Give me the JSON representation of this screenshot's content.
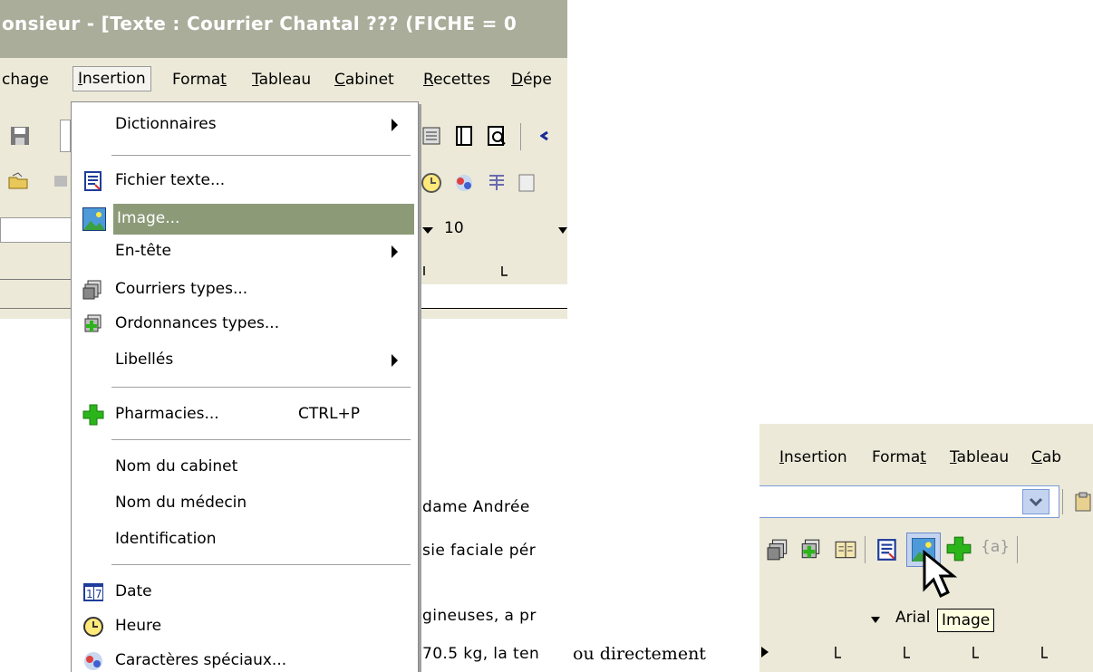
{
  "window": {
    "title": "onsieur - [Texte : Courrier Chantal ??? (FICHE = 0"
  },
  "menubar": {
    "items": [
      {
        "pre": "",
        "u": "",
        "post": "chage"
      },
      {
        "pre": "",
        "u": "I",
        "post": "nsertion"
      },
      {
        "pre": "Forma",
        "u": "t",
        "post": ""
      },
      {
        "pre": "",
        "u": "T",
        "post": "ableau"
      },
      {
        "pre": "",
        "u": "C",
        "post": "abinet"
      },
      {
        "pre": "",
        "u": "R",
        "post": "ecettes"
      },
      {
        "pre": "",
        "u": "D",
        "post": "épe"
      }
    ]
  },
  "toolbar": {
    "font_size": "10"
  },
  "insertion_menu": {
    "items": [
      {
        "label": "Dictionnaires",
        "icon": "none",
        "submenu": true
      },
      {
        "label": "Fichier texte...",
        "icon": "text-file-icon"
      },
      {
        "label": "Image...",
        "icon": "image-icon",
        "highlighted": true
      },
      {
        "label": "En-tête",
        "icon": "none",
        "submenu": true
      },
      {
        "label": "Courriers types...",
        "icon": "letter-templates-icon"
      },
      {
        "label": "Ordonnances types...",
        "icon": "prescription-templates-icon"
      },
      {
        "label": "Libellés",
        "icon": "none",
        "submenu": true
      },
      {
        "label": "Pharmacies...",
        "icon": "green-cross-icon",
        "shortcut": "CTRL+P"
      },
      {
        "label": "Nom du cabinet",
        "icon": "none"
      },
      {
        "label": "Nom du médecin",
        "icon": "none"
      },
      {
        "label": "Identification",
        "icon": "none"
      },
      {
        "label": "Date",
        "icon": "calendar-icon"
      },
      {
        "label": "Heure",
        "icon": "clock-icon"
      },
      {
        "label": "Caractères spéciaux...",
        "icon": "special-characters-icon"
      }
    ]
  },
  "document": {
    "lines": [
      "dame Andrée",
      "sie faciale pér",
      "gineuses, a pr",
      "70.5 kg, la ten"
    ]
  },
  "caption": "ou directement",
  "inset": {
    "menu_items": [
      {
        "pre": "",
        "u": "I",
        "post": "nsertion"
      },
      {
        "pre": "Forma",
        "u": "t",
        "post": ""
      },
      {
        "pre": "",
        "u": "T",
        "post": "ableau"
      },
      {
        "pre": "",
        "u": "C",
        "post": "ab"
      }
    ],
    "placeholder_glyph": "{a}",
    "font_name": "Arial",
    "tooltip": "Image"
  },
  "colors": {
    "title_bar": "#a9ad9a",
    "highlight": "#8c9a78",
    "chrome": "#ece9d8",
    "green_cross": "#2bb51a"
  }
}
